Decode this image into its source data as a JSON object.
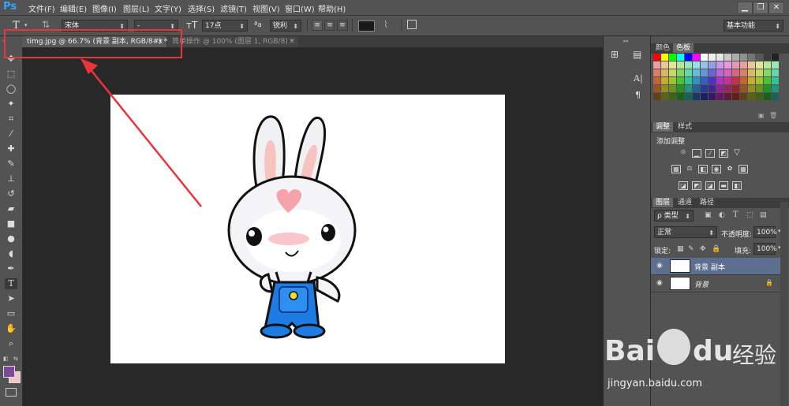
{
  "app": {
    "logo": "Ps"
  },
  "menu": [
    "文件(F)",
    "编辑(E)",
    "图像(I)",
    "图层(L)",
    "文字(Y)",
    "选择(S)",
    "滤镜(T)",
    "视图(V)",
    "窗口(W)",
    "帮助(H)"
  ],
  "window_controls": {
    "minimize": "▁",
    "restore": "❐",
    "close": "✕"
  },
  "options": {
    "font_family": "宋体",
    "font_style": "-",
    "font_size": "17点",
    "antialias_label": "ªa",
    "antialias": "锐利",
    "workspace": "基本功能"
  },
  "tabs": [
    {
      "label": "timg.jpg @ 66.7% (背景 副本, RGB/8#) *",
      "close": "×",
      "active": true
    },
    {
      "label": "简单操作 @ 100% (图层 1, RGB/8) *",
      "close": "×",
      "active": false
    }
  ],
  "color_panel": {
    "tabs": [
      "颜色",
      "色板"
    ]
  },
  "adjustments_panel": {
    "tabs": [
      "调整",
      "样式"
    ],
    "heading": "添加调整"
  },
  "layers_panel": {
    "tabs": [
      "图层",
      "通道",
      "路径"
    ],
    "filter_kind": "ρ 类型",
    "blend_mode": "正常",
    "opacity_label": "不透明度:",
    "opacity": "100%",
    "lock_label": "锁定:",
    "fill_label": "填充:",
    "fill": "100%",
    "layers": [
      {
        "name": "背景 副本",
        "selected": true
      },
      {
        "name": "背景",
        "selected": false,
        "locked": true
      }
    ]
  },
  "watermark": {
    "brand_left": "Bai",
    "brand_right": "du",
    "cn": "经验",
    "url": "jingyan.baidu.com"
  },
  "colors": {
    "accent": "#31a8ff",
    "highlight": "#e8353a",
    "foreground": "#7d4a9a",
    "background": "#f2c4c4"
  }
}
